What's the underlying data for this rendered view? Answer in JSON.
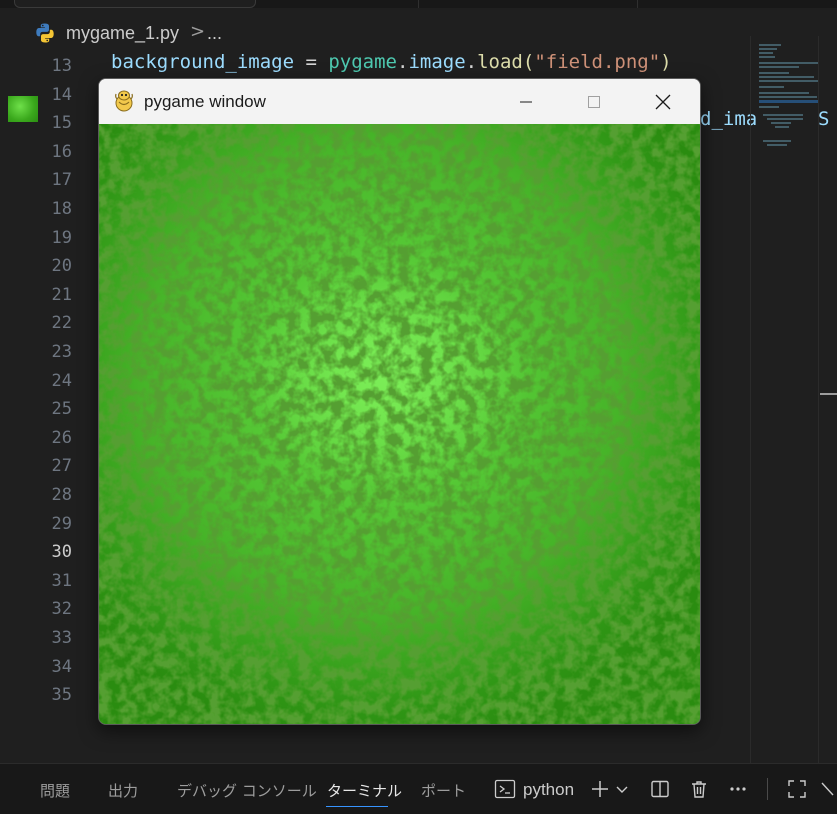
{
  "breadcrumb": {
    "file": "mygame_1.py",
    "separator": ">",
    "more": "..."
  },
  "editor": {
    "lines": [
      "13",
      "14",
      "15",
      "16",
      "17",
      "18",
      "19",
      "20",
      "21",
      "22",
      "23",
      "24",
      "25",
      "26",
      "27",
      "28",
      "29",
      "30",
      "31",
      "32",
      "33",
      "34",
      "35"
    ],
    "active_line": "30",
    "code_line_13": {
      "var": "background_image",
      "op": " = ",
      "module": "pygame",
      "dot1": ".",
      "attr": "image",
      "dot2": ".",
      "fn": "load",
      "lparen": "(",
      "str": "\"field.png\"",
      "rparen": ")"
    },
    "code_line_15_partial": "d_ima",
    "code_line_15_partial2": "S"
  },
  "pygame_window": {
    "title": "pygame window",
    "bg_color": "#3da41e"
  },
  "panel": {
    "tabs": [
      "問題",
      "出力",
      "デバッグ コンソール",
      "ターミナル",
      "ポート"
    ],
    "active_tab": "ターミナル",
    "terminal_label": "python",
    "accent": "#3794ff"
  }
}
